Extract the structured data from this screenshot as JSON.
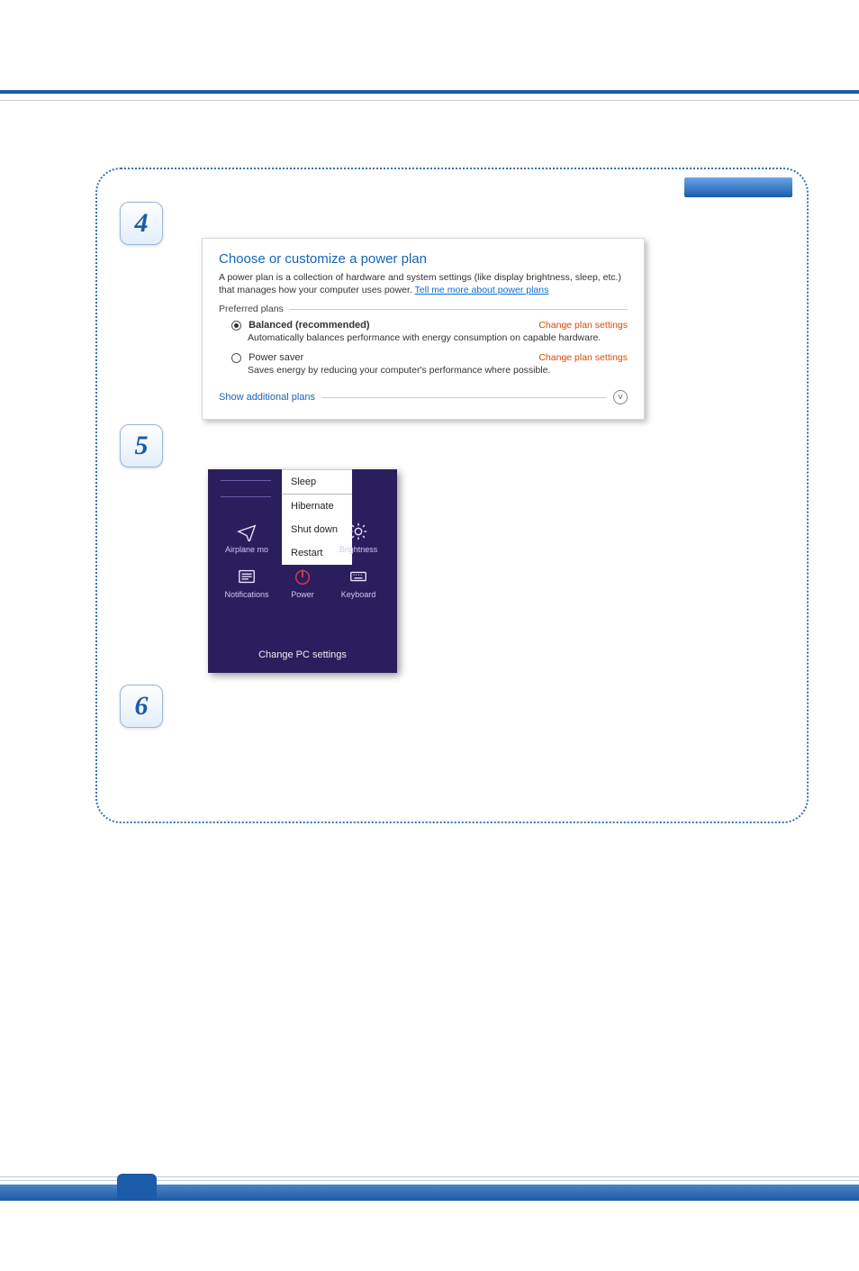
{
  "steps": {
    "s4": "4",
    "s5": "5",
    "s6": "6"
  },
  "powerPlan": {
    "heading": "Choose or customize a power plan",
    "desc_pre": "A power plan is a collection of hardware and system settings (like display brightness, sleep, etc.) that manages how your computer uses power. ",
    "desc_link": "Tell me more about power plans",
    "preferred_label": "Preferred plans",
    "plans": [
      {
        "name_bold": "Balanced (recommended)",
        "selected": true,
        "change": "Change plan settings",
        "desc": "Automatically balances performance with energy consumption on capable hardware."
      },
      {
        "name_plain": "Power saver",
        "selected": false,
        "change": "Change plan settings",
        "desc": "Saves energy by reducing your computer's performance where possible."
      }
    ],
    "show_additional": "Show additional plans"
  },
  "powerMenu": {
    "sleep": "Sleep",
    "hibernate": "Hibernate",
    "shutdown": "Shut down",
    "restart": "Restart"
  },
  "charm": {
    "airplane": "Airplane mo",
    "brightness": "Brightness",
    "notifications": "Notifications",
    "power": "Power",
    "keyboard": "Keyboard",
    "change_pc": "Change PC settings"
  }
}
